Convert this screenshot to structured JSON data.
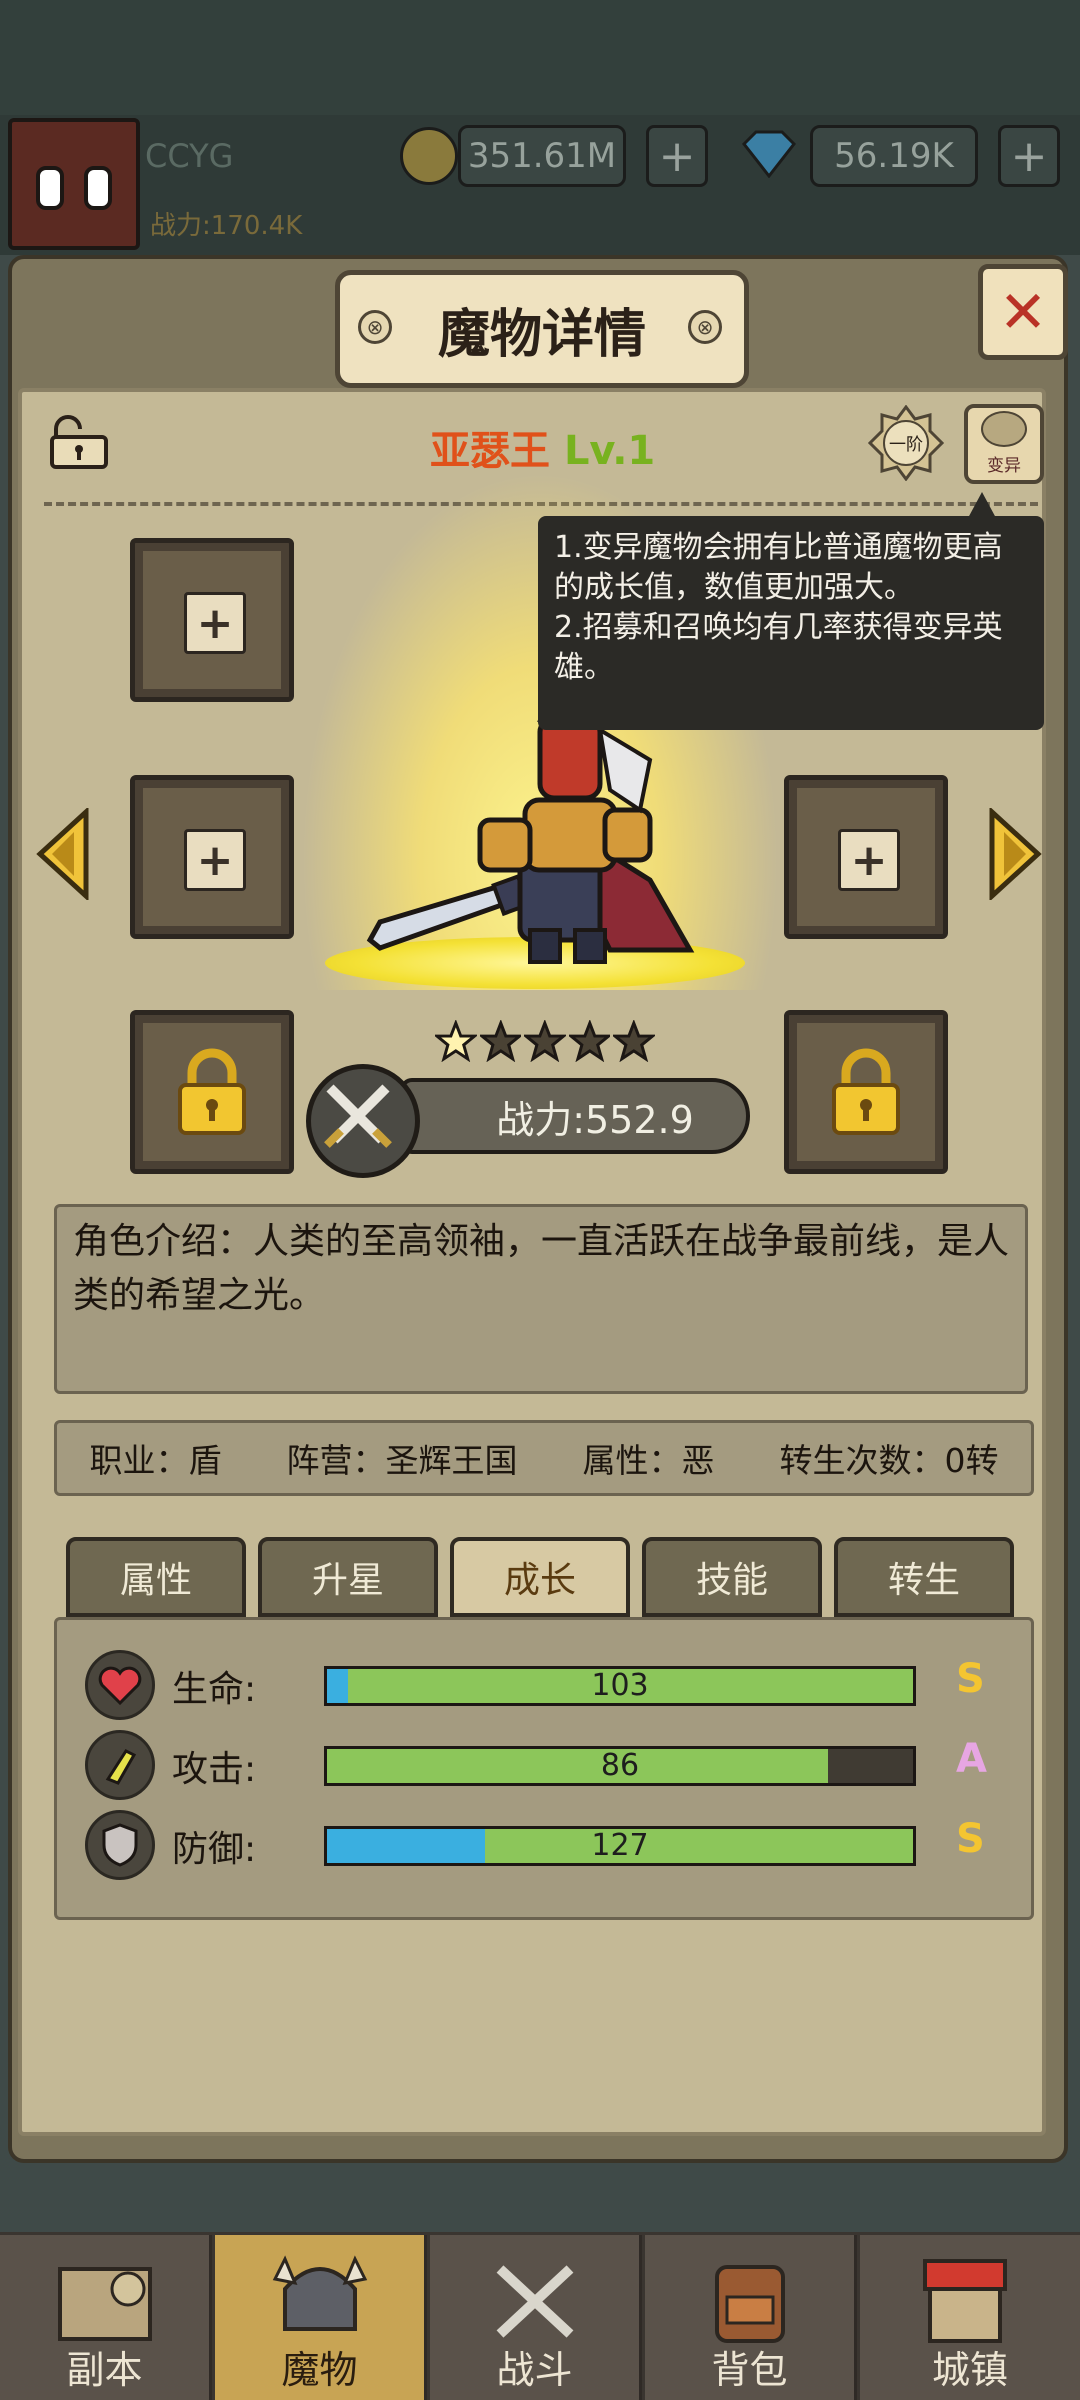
{
  "status_bar": {
    "username": "CCYG",
    "power": "战力:170.4K",
    "gold": "351.61M",
    "gems": "56.19K",
    "plus": "+"
  },
  "dialog": {
    "title": "魔物详情",
    "close": "✕",
    "monster_name": "亚瑟王",
    "level": "Lv.1",
    "rank_badge": "一阶",
    "mutant_button": "变异",
    "tooltip_line1": "1.变异魔物会拥有比普通魔物更高的成长值，数值更加强大。",
    "tooltip_line2": "2.招募和召唤均有几率获得变异英雄。",
    "stars_filled": 1,
    "stars_total": 5,
    "power": "战力:552.9",
    "description": "角色介绍：人类的至高领袖，一直活跃在战争最前线，是人类的希望之光。",
    "info": {
      "job": "职业：盾",
      "faction": "阵营：圣辉王国",
      "attribute": "属性：恶",
      "rebirth": "转生次数：0转"
    },
    "tabs": [
      "属性",
      "升星",
      "成长",
      "技能",
      "转生"
    ],
    "active_tab": 2,
    "stats": [
      {
        "label": "生命:",
        "value": "103",
        "grade": "S",
        "fill": 1.0,
        "blue": 0.035,
        "grade_color": "#f4c531"
      },
      {
        "label": "攻击:",
        "value": "86",
        "grade": "A",
        "fill": 0.855,
        "blue": 0.0,
        "grade_color": "#e7a6e3"
      },
      {
        "label": "防御:",
        "value": "127",
        "grade": "S",
        "fill": 1.0,
        "blue": 0.27,
        "grade_color": "#f4c531"
      }
    ]
  },
  "bottom_nav": [
    "副本",
    "魔物",
    "战斗",
    "背包",
    "城镇"
  ],
  "active_nav": 1
}
